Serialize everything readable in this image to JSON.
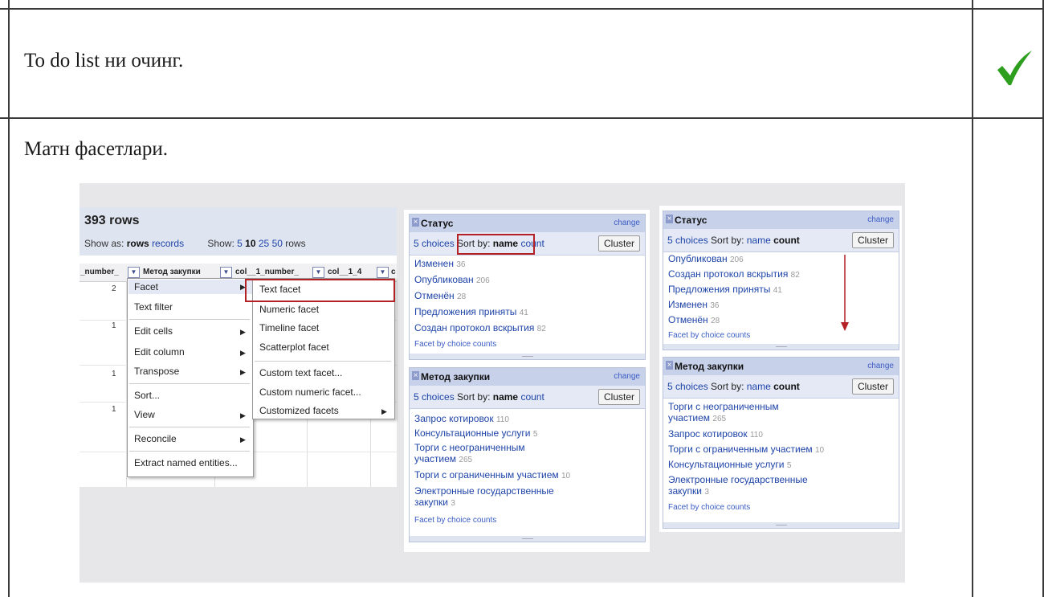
{
  "rows": [
    {
      "text": "To do list ни очинг.",
      "checked": true
    },
    {
      "text": "Матн фасетлари.",
      "checked": false
    }
  ],
  "refine": {
    "rows_title": "393 rows",
    "show_as_label": "Show as:",
    "show_as_rows": "rows",
    "show_as_records": "records",
    "show_label": "Show:",
    "show_options": [
      "5",
      "10",
      "25",
      "50"
    ],
    "show_selected": "10",
    "show_rows": "rows",
    "columns": [
      "_number_",
      "Метод закупки",
      "col__1_number_",
      "col__1_4",
      "c"
    ],
    "row_nums": [
      "2",
      "1",
      "1",
      "1"
    ],
    "column_menu": [
      "Facet",
      "Text filter",
      "Edit cells",
      "Edit column",
      "Transpose",
      "Sort...",
      "View",
      "Reconcile",
      "Extract named entities..."
    ],
    "facet_submenu": [
      "Text facet",
      "Numeric facet",
      "Timeline facet",
      "Scatterplot facet",
      "Custom text facet...",
      "Custom numeric facet...",
      "Customized facets"
    ]
  },
  "facets_name": {
    "status": {
      "title": "Статус",
      "change": "change",
      "choices": "5 choices",
      "sort_by": "Sort by:",
      "name": "name",
      "count": "count",
      "cluster": "Cluster",
      "items": [
        {
          "label": "Изменен",
          "count": "36"
        },
        {
          "label": "Опубликован",
          "count": "206"
        },
        {
          "label": "Отменён",
          "count": "28"
        },
        {
          "label": "Предложения приняты",
          "count": "41"
        },
        {
          "label": "Создан протокол вскрытия",
          "count": "82"
        }
      ],
      "footer": "Facet by choice counts"
    },
    "method": {
      "title": "Метод закупки",
      "change": "change",
      "choices": "5 choices",
      "sort_by": "Sort by:",
      "name": "name",
      "count": "count",
      "cluster": "Cluster",
      "items": [
        {
          "label": "Запрос котировок",
          "count": "110"
        },
        {
          "label": "Консультационные услуги",
          "count": "5"
        },
        {
          "label": "Торги с неограниченным",
          "label2": "участием",
          "count": "265"
        },
        {
          "label": "Торги с ограниченным участием",
          "count": "10"
        },
        {
          "label": "Электронные государственные",
          "label2": "закупки",
          "count": "3"
        }
      ],
      "footer": "Facet by choice counts"
    }
  },
  "facets_count": {
    "status": {
      "title": "Статус",
      "change": "change",
      "choices": "5 choices",
      "sort_by": "Sort by:",
      "name": "name",
      "count": "count",
      "cluster": "Cluster",
      "items": [
        {
          "label": "Опубликован",
          "count": "206"
        },
        {
          "label": "Создан протокол вскрытия",
          "count": "82"
        },
        {
          "label": "Предложения приняты",
          "count": "41"
        },
        {
          "label": "Изменен",
          "count": "36"
        },
        {
          "label": "Отменён",
          "count": "28"
        }
      ],
      "footer": "Facet by choice counts"
    },
    "method": {
      "title": "Метод закупки",
      "change": "change",
      "choices": "5 choices",
      "sort_by": "Sort by:",
      "name": "name",
      "count": "count",
      "cluster": "Cluster",
      "items": [
        {
          "label": "Торги с неограниченным",
          "label2": "участием",
          "count": "265"
        },
        {
          "label": "Запрос котировок",
          "count": "110"
        },
        {
          "label": "Торги с ограниченным участием",
          "count": "10"
        },
        {
          "label": "Консультационные услуги",
          "count": "5"
        },
        {
          "label": "Электронные государственные",
          "label2": "закупки",
          "count": "3"
        }
      ],
      "footer": "Facet by choice counts"
    }
  },
  "colors": {
    "accent_red": "#b32127",
    "check_green": "#2e9e1f",
    "link": "#1e44a8",
    "panel_header": "#c8d1ea"
  }
}
